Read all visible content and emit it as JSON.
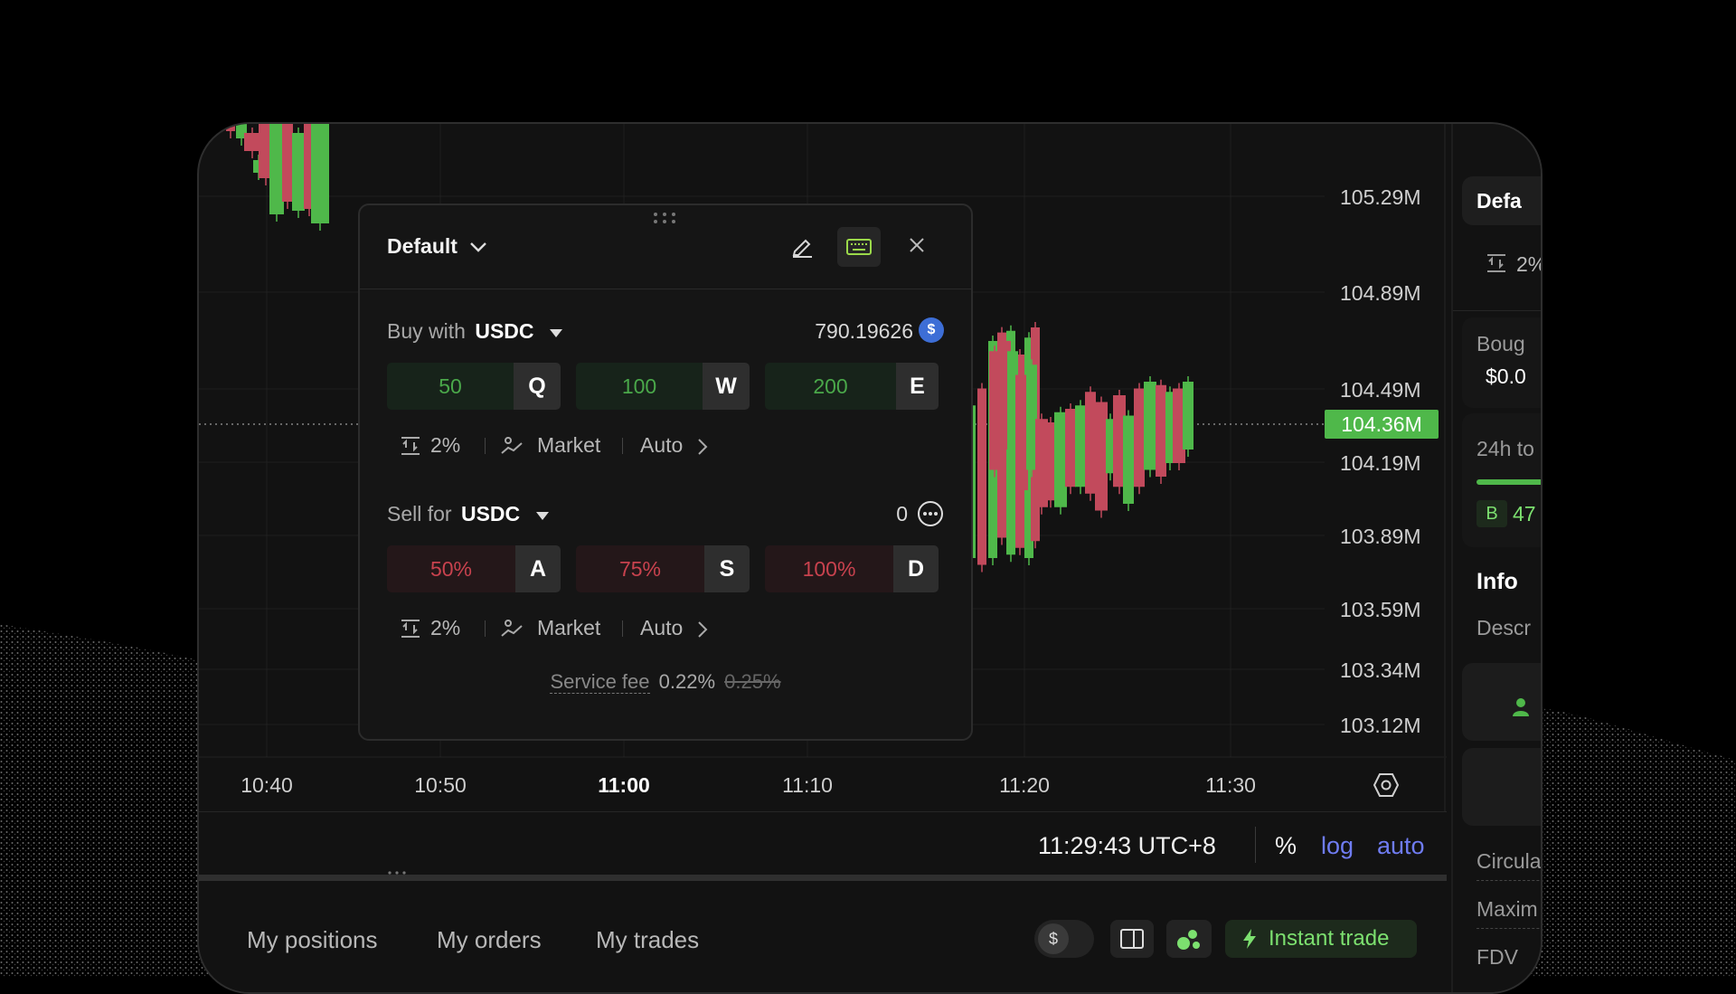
{
  "chart": {
    "price_axis": [
      "105.29M",
      "104.89M",
      "104.49M",
      "104.19M",
      "103.89M",
      "103.59M",
      "103.34M",
      "103.12M"
    ],
    "current_price": "104.36M",
    "time_axis": [
      "10:40",
      "10:50",
      "11:00",
      "11:10",
      "11:20",
      "11:30"
    ],
    "up_color": "#4fb84a",
    "down_color": "#c24a5c"
  },
  "status_bar": {
    "clock": "11:29:43 UTC+8",
    "percent": "%",
    "log": "log",
    "auto": "auto"
  },
  "tabs": {
    "positions": "My positions",
    "orders": "My orders",
    "trades": "My trades",
    "currency": "$",
    "instant_trade": "Instant trade"
  },
  "popup": {
    "preset": "Default",
    "buy": {
      "label": "Buy with",
      "token": "USDC",
      "balance": "790.19626",
      "balance_icon": "$",
      "amounts": [
        {
          "value": "50",
          "key": "Q"
        },
        {
          "value": "100",
          "key": "W"
        },
        {
          "value": "200",
          "key": "E"
        }
      ],
      "slippage": "2%",
      "order_type": "Market",
      "mode": "Auto"
    },
    "sell": {
      "label": "Sell for",
      "token": "USDC",
      "balance": "0",
      "amounts": [
        {
          "value": "50%",
          "key": "A"
        },
        {
          "value": "75%",
          "key": "S"
        },
        {
          "value": "100%",
          "key": "D"
        }
      ],
      "slippage": "2%",
      "order_type": "Market",
      "mode": "Auto"
    },
    "fee_label": "Service fee",
    "fee_value": "0.22%",
    "fee_old": "0.25%"
  },
  "right_panel": {
    "preset": "Defa",
    "slippage": "2%",
    "bought_label": "Boug",
    "bought_value": "$0.0",
    "vol_label": "24h to",
    "vol_b": "B",
    "vol_value": "47",
    "info_title": "Info",
    "desc_label": "Descr",
    "circ_label": "Circula",
    "max_label": "Maxim",
    "fdv_label": "FDV"
  }
}
